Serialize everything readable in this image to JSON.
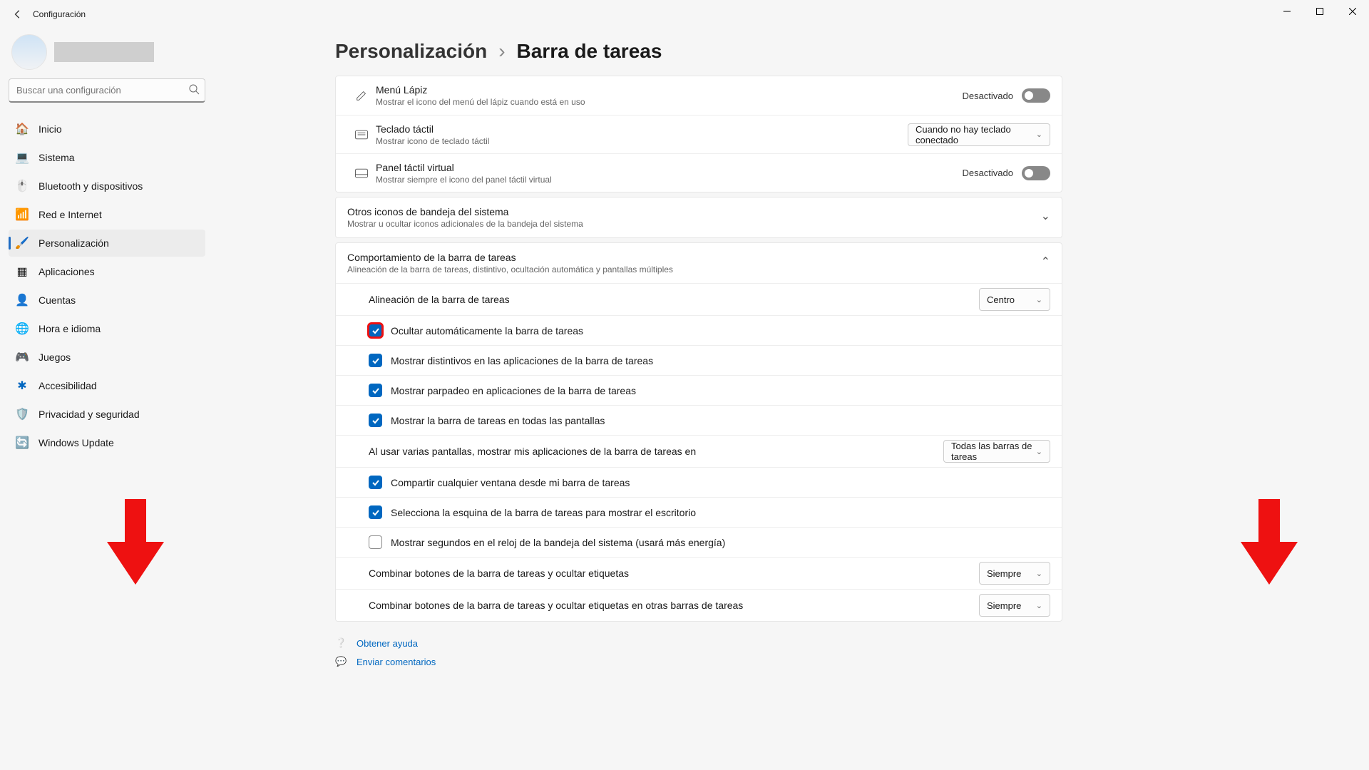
{
  "window": {
    "title": "Configuración",
    "buttons": {
      "min": "min",
      "max": "max",
      "close": "close"
    }
  },
  "search": {
    "placeholder": "Buscar una configuración"
  },
  "sidebar": {
    "items": [
      {
        "icon": "home",
        "label": "Inicio",
        "color": "#f5a623"
      },
      {
        "icon": "system",
        "label": "Sistema",
        "color": "#2b7de9"
      },
      {
        "icon": "bt",
        "label": "Bluetooth y dispositivos",
        "color": "#2b7de9"
      },
      {
        "icon": "net",
        "label": "Red e Internet",
        "color": "#2b7de9"
      },
      {
        "icon": "pers",
        "label": "Personalización",
        "color": "#f5a623",
        "active": true
      },
      {
        "icon": "apps",
        "label": "Aplicaciones",
        "color": "#7b61ff"
      },
      {
        "icon": "acct",
        "label": "Cuentas",
        "color": "#3bb273"
      },
      {
        "icon": "time",
        "label": "Hora e idioma",
        "color": "#2b7de9"
      },
      {
        "icon": "game",
        "label": "Juegos",
        "color": "#888"
      },
      {
        "icon": "acc",
        "label": "Accesibilidad",
        "color": "#0067c0"
      },
      {
        "icon": "priv",
        "label": "Privacidad y seguridad",
        "color": "#888"
      },
      {
        "icon": "upd",
        "label": "Windows Update",
        "color": "#0067c0"
      }
    ]
  },
  "breadcrumb": {
    "parent": "Personalización",
    "sep": "›",
    "current": "Barra de tareas"
  },
  "rows": {
    "pen": {
      "title": "Menú Lápiz",
      "desc": "Mostrar el icono del menú del lápiz cuando está en uso",
      "state": "Desactivado"
    },
    "touchk": {
      "title": "Teclado táctil",
      "desc": "Mostrar icono de teclado táctil",
      "drop": "Cuando no hay teclado conectado"
    },
    "vtp": {
      "title": "Panel táctil virtual",
      "desc": "Mostrar siempre el icono del panel táctil virtual",
      "state": "Desactivado"
    }
  },
  "groups": {
    "tray": {
      "title": "Otros iconos de bandeja del sistema",
      "desc": "Mostrar u ocultar iconos adicionales de la bandeja del sistema"
    },
    "behav": {
      "title": "Comportamiento de la barra de tareas",
      "desc": "Alineación de la barra de tareas, distintivo, ocultación automática y pantallas múltiples"
    }
  },
  "behav": {
    "align": {
      "label": "Alineación de la barra de tareas",
      "value": "Centro"
    },
    "autohide": {
      "label": "Ocultar automáticamente la barra de tareas",
      "checked": true,
      "highlight": true
    },
    "badges": {
      "label": "Mostrar distintivos en las aplicaciones de la barra de tareas",
      "checked": true
    },
    "flash": {
      "label": "Mostrar parpadeo en aplicaciones de la barra de tareas",
      "checked": true
    },
    "allscreens": {
      "label": "Mostrar la barra de tareas en todas las pantallas",
      "checked": true
    },
    "multi": {
      "label": "Al usar varias pantallas, mostrar mis aplicaciones de la barra de tareas en",
      "value": "Todas las barras de tareas"
    },
    "share": {
      "label": "Compartir cualquier ventana desde mi barra de tareas",
      "checked": true
    },
    "corner": {
      "label": "Selecciona la esquina de la barra de tareas para mostrar el escritorio",
      "checked": true
    },
    "seconds": {
      "label": "Mostrar segundos en el reloj de la bandeja del sistema (usará más energía)",
      "checked": false
    },
    "combine1": {
      "label": "Combinar botones de la barra de tareas y ocultar etiquetas",
      "value": "Siempre"
    },
    "combine2": {
      "label": "Combinar botones de la barra de tareas y ocultar etiquetas en otras barras de tareas",
      "value": "Siempre"
    }
  },
  "footer": {
    "help": "Obtener ayuda",
    "feedback": "Enviar comentarios"
  }
}
